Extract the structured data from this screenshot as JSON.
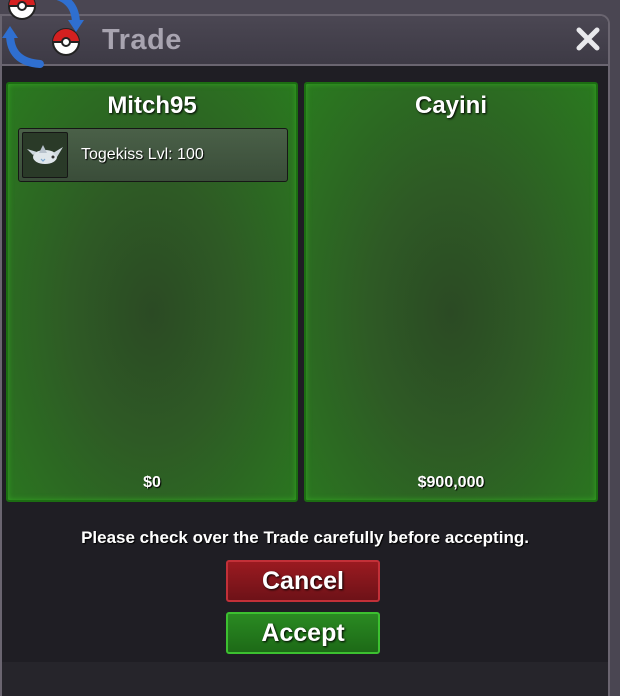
{
  "window": {
    "title": "Trade"
  },
  "trade": {
    "left": {
      "player": "Mitch95",
      "items": [
        {
          "label": "Togekiss  Lvl: 100",
          "icon": "togekiss-sprite-icon"
        }
      ],
      "money": "$0"
    },
    "right": {
      "player": "Cayini",
      "items": [],
      "money": "$900,000"
    }
  },
  "notice": "Please check over the Trade carefully before accepting.",
  "buttons": {
    "cancel": "Cancel",
    "accept": "Accept"
  },
  "colors": {
    "panel_green": "#2e5a25",
    "cancel_red": "#9a1a20",
    "accept_green": "#2a8a22"
  }
}
